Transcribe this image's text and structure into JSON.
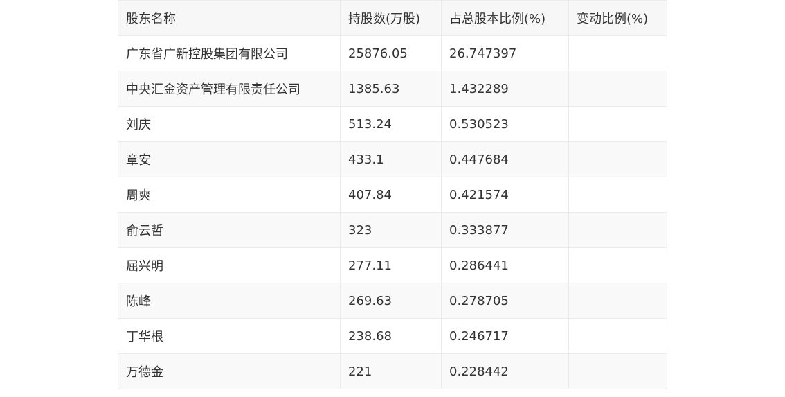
{
  "table": {
    "headers": [
      "股东名称",
      "持股数(万股)",
      "占总股本比例(%)",
      "变动比例(%)"
    ],
    "rows": [
      [
        "广东省广新控股集团有限公司",
        "25876.05",
        "26.747397",
        ""
      ],
      [
        "中央汇金资产管理有限责任公司",
        "1385.63",
        "1.432289",
        ""
      ],
      [
        "刘庆",
        "513.24",
        "0.530523",
        ""
      ],
      [
        "章安",
        "433.1",
        "0.447684",
        ""
      ],
      [
        "周爽",
        "407.84",
        "0.421574",
        ""
      ],
      [
        "俞云哲",
        "323",
        "0.333877",
        ""
      ],
      [
        "屈兴明",
        "277.11",
        "0.286441",
        ""
      ],
      [
        "陈峰",
        "269.63",
        "0.278705",
        ""
      ],
      [
        "丁华根",
        "238.68",
        "0.246717",
        ""
      ],
      [
        "万德金",
        "221",
        "0.228442",
        ""
      ]
    ]
  }
}
